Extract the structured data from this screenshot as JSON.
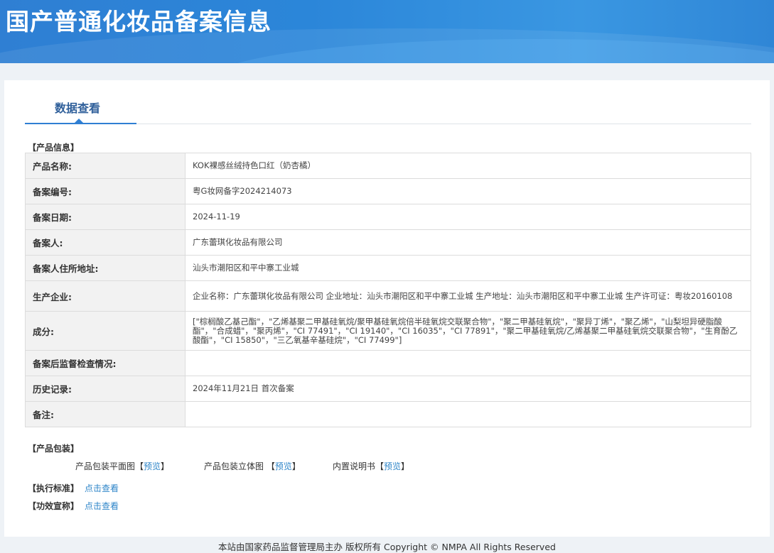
{
  "page": {
    "title": "国产普通化妆品备案信息",
    "tab": "数据查看"
  },
  "product_info": {
    "section_title": "【产品信息】",
    "rows": [
      {
        "label": "产品名称:",
        "value": "KOK裸感丝绒持色口红（奶杏橘）"
      },
      {
        "label": "备案编号:",
        "value": "粤G妆网备字2024214073"
      },
      {
        "label": "备案日期:",
        "value": "2024-11-19"
      },
      {
        "label": "备案人:",
        "value": "广东蕾琪化妆品有限公司"
      },
      {
        "label": "备案人住所地址:",
        "value": "汕头市潮阳区和平中寨工业城"
      },
      {
        "label": "生产企业:",
        "value": "企业名称：广东蕾琪化妆品有限公司 企业地址：汕头市潮阳区和平中寨工业城 生产地址：汕头市潮阳区和平中寨工业城 生产许可证：粤妆20160108"
      },
      {
        "label": "成分:",
        "value": "[\"棕榈酸乙基己酯\"，\"乙烯基聚二甲基硅氧烷/聚甲基硅氧烷倍半硅氧烷交联聚合物\"，\"聚二甲基硅氧烷\"，\"聚异丁烯\"，\"聚乙烯\"，\"山梨坦异硬脂酸酯\"，\"合成蜡\"，\"聚丙烯\"，\"CI 77491\"，\"CI 19140\"，\"CI 16035\"，\"CI 77891\"，\"聚二甲基硅氧烷/乙烯基聚二甲基硅氧烷交联聚合物\"，\"生育酚乙酸酯\"，\"CI 15850\"，\"三乙氧基辛基硅烷\"，\"CI 77499\"]"
      },
      {
        "label": "备案后监督检查情况:",
        "value": ""
      },
      {
        "label": "历史记录:",
        "value": "2024年11月21日 首次备案"
      },
      {
        "label": "备注:",
        "value": ""
      }
    ]
  },
  "packaging": {
    "section_title": "【产品包装】",
    "items": [
      {
        "label": "产品包装平面图",
        "link": "预览"
      },
      {
        "label": "产品包装立体图 ",
        "link": "预览"
      },
      {
        "label": "内置说明书",
        "link": "预览"
      }
    ]
  },
  "standard": {
    "label": "【执行标准】",
    "link": "点击查看"
  },
  "efficacy": {
    "label": "【功效宣称】",
    "link": "点击查看"
  },
  "footer": "本站由国家药品监督管理局主办 版权所有 Copyright © NMPA All Rights Reserved",
  "colors": {
    "banner": "#2f7fd3",
    "link": "#2f86c9",
    "tab_text": "#2f5f9a"
  }
}
